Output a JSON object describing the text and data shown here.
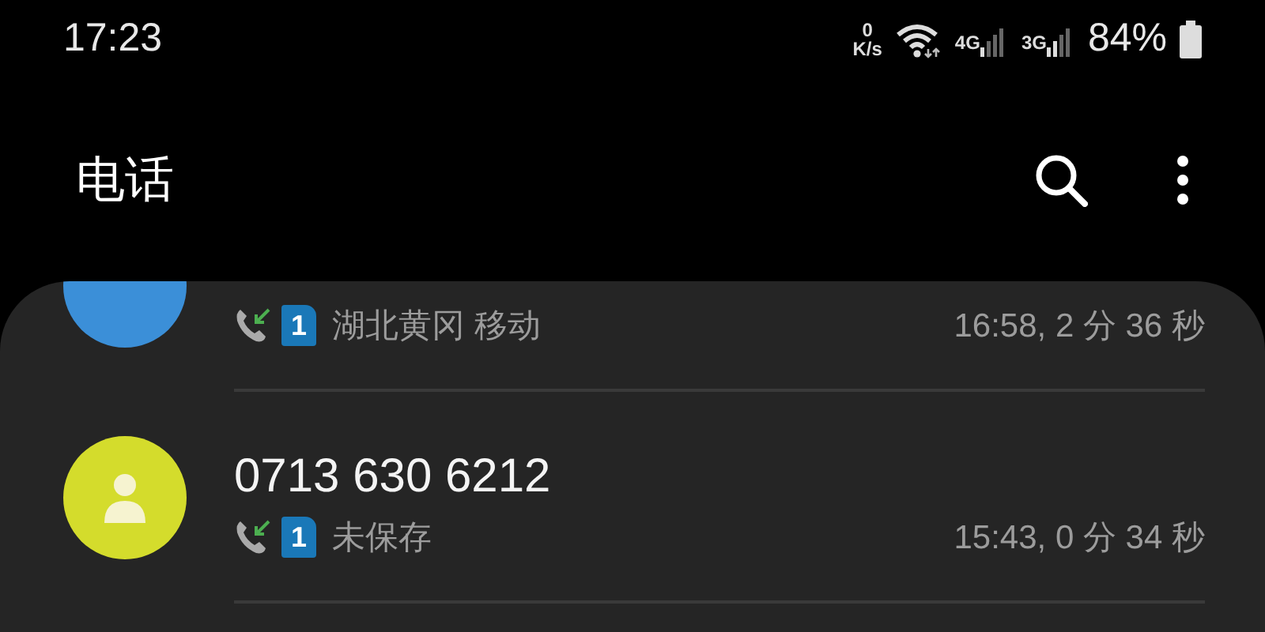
{
  "status_bar": {
    "time": "17:23",
    "speed_value": "0",
    "speed_unit": "K/s",
    "network_1": "4G",
    "network_2": "3G",
    "battery": "84%"
  },
  "header": {
    "title": "电话"
  },
  "calls": [
    {
      "avatar": {
        "kind": "letter",
        "color": "#3b8fd8"
      },
      "incoming": true,
      "sim": "1",
      "detail": "湖北黄冈 移动",
      "time": "16:58, 2 分 36 秒"
    },
    {
      "avatar": {
        "kind": "person",
        "color": "#d4dc2c"
      },
      "name": "0713 630 6212",
      "incoming": true,
      "sim": "1",
      "detail": "未保存",
      "time": "15:43, 0 分 34 秒"
    }
  ]
}
